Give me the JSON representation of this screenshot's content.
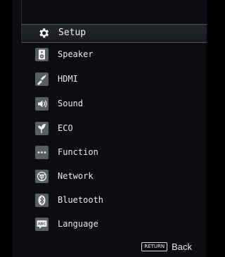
{
  "header": {
    "title": "Setup",
    "icon": "gear-icon"
  },
  "menu": {
    "items": [
      {
        "label": "Speaker",
        "icon": "speaker-icon"
      },
      {
        "label": "HDMI",
        "icon": "hdmi-icon"
      },
      {
        "label": "Sound",
        "icon": "sound-icon"
      },
      {
        "label": "ECO",
        "icon": "eco-leaf-icon"
      },
      {
        "label": "Function",
        "icon": "function-dots-icon"
      },
      {
        "label": "Network",
        "icon": "network-icon"
      },
      {
        "label": "Bluetooth",
        "icon": "bluetooth-icon"
      },
      {
        "label": "Language",
        "icon": "language-icon"
      }
    ]
  },
  "footer": {
    "return_key": "RETURN",
    "back_label": "Back"
  },
  "colors": {
    "background": "#0b0d10",
    "header_bar": "#1f2227",
    "icon_tile": "#5a5d62",
    "text": "#e8e8e8"
  }
}
